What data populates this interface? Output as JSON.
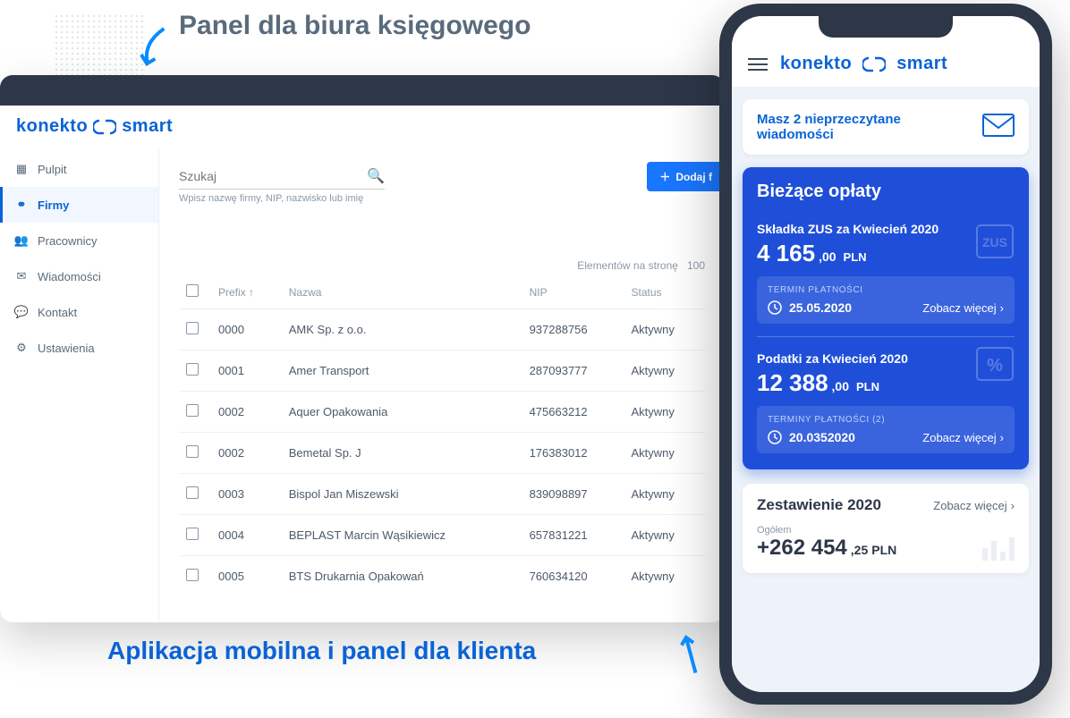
{
  "captions": {
    "top": "Panel dla biura księgowego",
    "bottom": "Aplikacja mobilna i panel dla klienta"
  },
  "brand": {
    "name1": "konekto",
    "name2": "smart"
  },
  "sidebar": {
    "items": [
      {
        "label": "Pulpit",
        "icon": "dashboard"
      },
      {
        "label": "Firmy",
        "icon": "companies",
        "active": true
      },
      {
        "label": "Pracownicy",
        "icon": "people"
      },
      {
        "label": "Wiadomości",
        "icon": "mail"
      },
      {
        "label": "Kontakt",
        "icon": "chat"
      },
      {
        "label": "Ustawienia",
        "icon": "gear"
      }
    ]
  },
  "search": {
    "placeholder": "Szukaj",
    "hint": "Wpisz nazwę firmy, NIP, nazwisko lub imię"
  },
  "add_button": "Dodaj f",
  "pager": {
    "label": "Elementów na stronę",
    "value": "100"
  },
  "table": {
    "headers": [
      "Prefix",
      "Nazwa",
      "NIP",
      "Status"
    ],
    "rows": [
      {
        "prefix": "0000",
        "name": "AMK Sp. z o.o.",
        "nip": "937288756",
        "status": "Aktywny"
      },
      {
        "prefix": "0001",
        "name": "Amer Transport",
        "nip": "287093777",
        "status": "Aktywny"
      },
      {
        "prefix": "0002",
        "name": "Aquer Opakowania",
        "nip": "475663212",
        "status": "Aktywny"
      },
      {
        "prefix": "0002",
        "name": "Bemetal Sp. J",
        "nip": "176383012",
        "status": "Aktywny"
      },
      {
        "prefix": "0003",
        "name": "Bispol Jan Miszewski",
        "nip": "839098897",
        "status": "Aktywny"
      },
      {
        "prefix": "0004",
        "name": "BEPLAST Marcin Wąsikiewicz",
        "nip": "657831221",
        "status": "Aktywny"
      },
      {
        "prefix": "0005",
        "name": "BTS Drukarnia Opakowań",
        "nip": "760634120",
        "status": "Aktywny"
      }
    ]
  },
  "mobile": {
    "unread": "Masz 2 nieprzeczytane wiadomości",
    "fees_title": "Bieżące opłaty",
    "fees": [
      {
        "label": "Składka ZUS za Kwiecień 2020",
        "big": "4 165",
        "small": ",00",
        "cur": "PLN",
        "deadline_title": "TERMIN PŁATNOŚCI",
        "date": "25.05.2020",
        "more": "Zobacz więcej",
        "corner": "ZUS"
      },
      {
        "label": "Podatki za Kwiecień 2020",
        "big": "12 388",
        "small": ",00",
        "cur": "PLN",
        "deadline_title": "TERMINY PŁATNOŚCI (2)",
        "date": "20.0352020",
        "more": "Zobacz więcej",
        "corner": "%"
      }
    ],
    "summary": {
      "title": "Zestawienie 2020",
      "more": "Zobacz więcej",
      "total_label": "Ogółem",
      "big": "+262 454",
      "small": ",25",
      "cur": "PLN"
    }
  }
}
